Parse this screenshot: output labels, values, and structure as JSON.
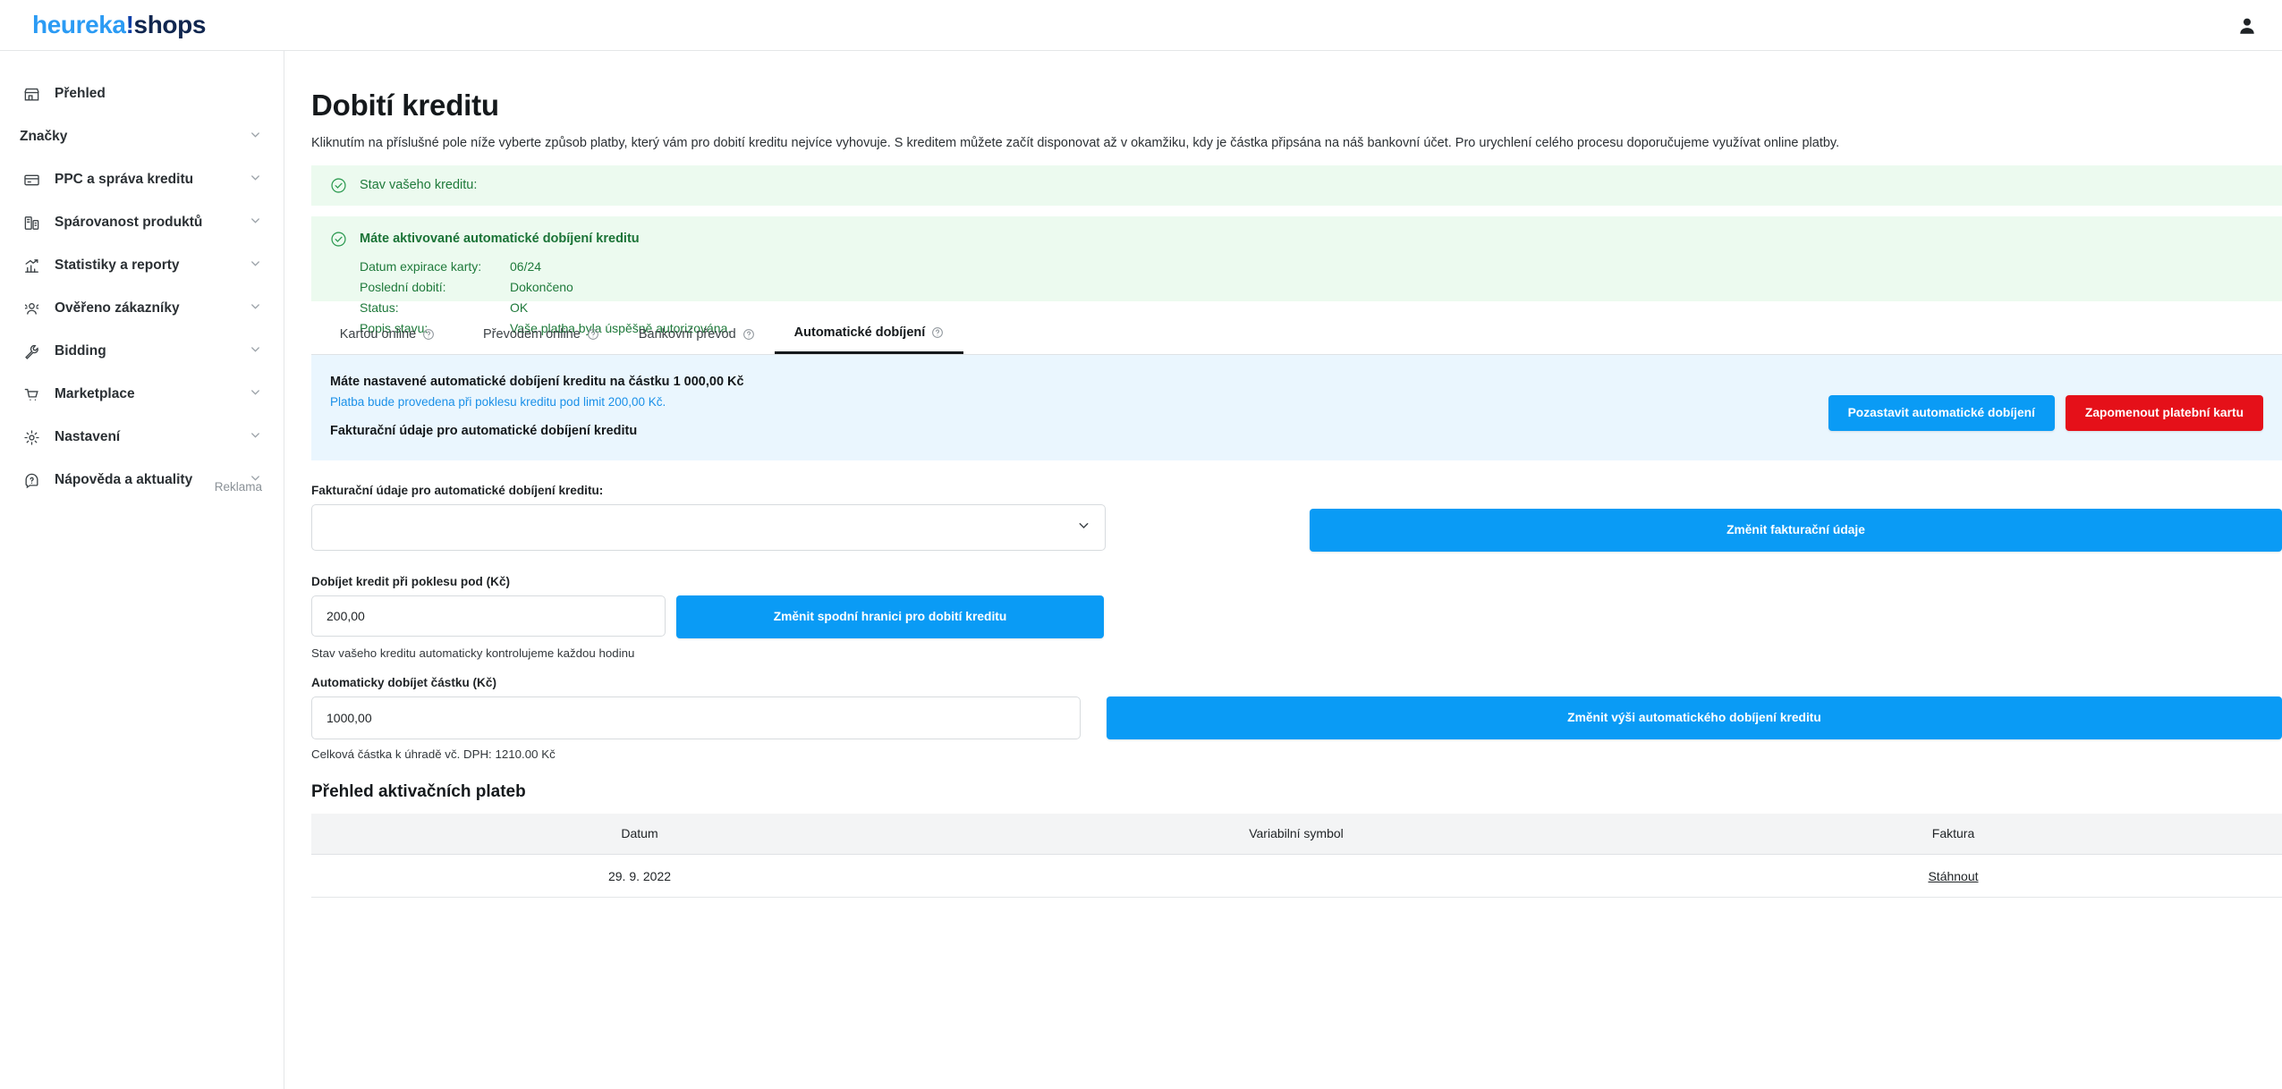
{
  "brand": {
    "part1": "heureka",
    "part2": "!",
    "part3": "shops"
  },
  "header": {
    "user_icon": "user-icon"
  },
  "sidebar": {
    "reklama_label": "Reklama",
    "items": [
      {
        "label": "Přehled",
        "icon": "store-icon",
        "chevron": false
      },
      {
        "label": "Značky",
        "icon": "",
        "chevron": true
      },
      {
        "label": "PPC a správa kreditu",
        "icon": "credit-card-icon",
        "chevron": true
      },
      {
        "label": "Spárovanost produktů",
        "icon": "products-icon",
        "chevron": true
      },
      {
        "label": "Statistiky a reporty",
        "icon": "chart-icon",
        "chevron": true
      },
      {
        "label": "Ověřeno zákazníky",
        "icon": "customers-icon",
        "chevron": true
      },
      {
        "label": "Bidding",
        "icon": "wrench-icon",
        "chevron": true
      },
      {
        "label": "Marketplace",
        "icon": "cart-icon",
        "chevron": true
      },
      {
        "label": "Nastavení",
        "icon": "gear-icon",
        "chevron": true
      },
      {
        "label": "Nápověda a aktuality",
        "icon": "help-icon",
        "chevron": true
      }
    ]
  },
  "main": {
    "title": "Dobití kreditu",
    "description": "Kliknutím na příslušné pole níže vyberte způsob platby, který vám pro dobití kreditu nejvíce vyhovuje. S kreditem můžete začít disponovat až v okamžiku, kdy je částka připsána na náš bankovní účet. Pro urychlení celého procesu doporučujeme využívat online platby.",
    "banner_credit": {
      "text": "Stav vašeho kreditu:"
    },
    "banner_auto": {
      "heading": "Máte aktivované automatické dobíjení kreditu",
      "rows": [
        {
          "key": "Datum expirace karty:",
          "value": "06/24"
        },
        {
          "key": "Poslední dobití:",
          "value": "Dokončeno"
        },
        {
          "key": "Status:",
          "value": "OK"
        },
        {
          "key": "Popis stavu:",
          "value": "Vaše platba byla úspěšně autorizována."
        }
      ]
    },
    "tabs": [
      {
        "label": "Kartou online",
        "active": false
      },
      {
        "label": "Převodem online",
        "active": false
      },
      {
        "label": "Bankovní převod",
        "active": false
      },
      {
        "label": "Automatické dobíjení",
        "active": true
      }
    ],
    "blue_panel": {
      "line1": "Máte nastavené automatické dobíjení kreditu na částku 1 000,00 Kč",
      "line2": "Platba bude provedena při poklesu kreditu pod limit 200,00 Kč.",
      "line3": "Fakturační údaje pro automatické dobíjení kreditu",
      "btn_pause": "Pozastavit automatické dobíjení",
      "btn_forget": "Zapomenout platební kartu"
    },
    "form": {
      "billing_label": "Fakturační údaje pro automatické dobíjení kreditu:",
      "billing_value": "",
      "btn_change_billing": "Změnit fakturační údaje",
      "threshold_label": "Dobíjet kredit při poklesu pod (Kč)",
      "threshold_value": "200,00",
      "btn_change_threshold": "Změnit spodní hranici pro dobití kreditu",
      "threshold_note": "Stav vašeho kreditu automaticky kontrolujeme každou hodinu",
      "amount_label": "Automaticky dobíjet částku (Kč)",
      "amount_value": "1000,00",
      "btn_change_amount": "Změnit výši automatického dobíjení kreditu",
      "amount_note": "Celková částka k úhradě vč. DPH: 1210.00 Kč"
    },
    "payments": {
      "title": "Přehled aktivačních plateb",
      "columns": [
        "Datum",
        "Variabilní symbol",
        "Faktura"
      ],
      "rows": [
        {
          "datum": "29. 9. 2022",
          "symbol": "",
          "faktura": "Stáhnout"
        }
      ]
    }
  },
  "colors": {
    "brand_blue": "#2b9bf4",
    "brand_dark": "#10264f",
    "accent_blue": "#0a9bf5",
    "danger_red": "#e51019",
    "success_green": "#1d7a3a",
    "banner_green_bg": "#ecfaef",
    "panel_blue_bg": "#eaf6fe"
  }
}
